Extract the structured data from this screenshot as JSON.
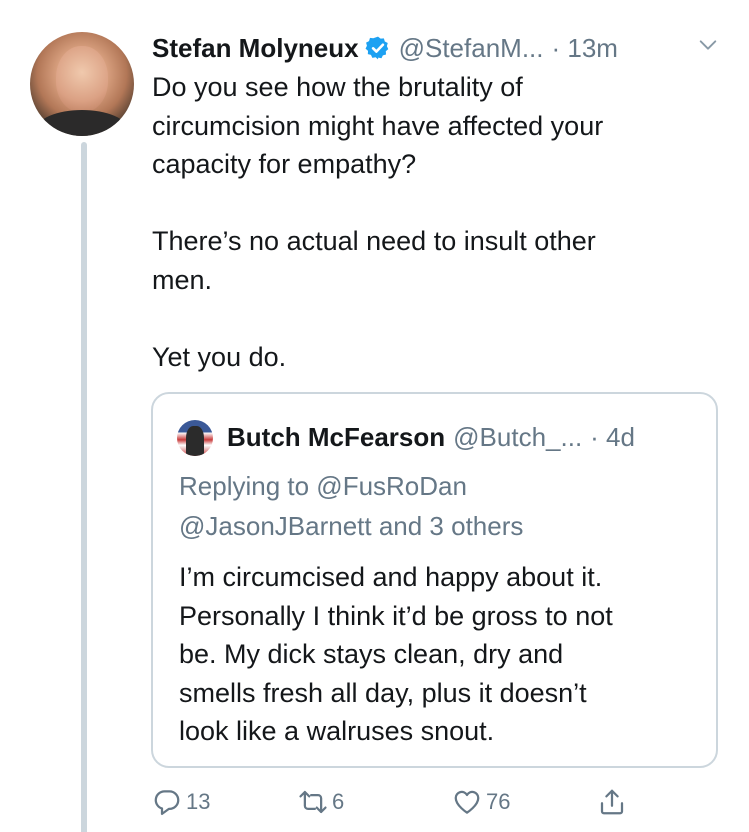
{
  "tweet": {
    "author_name": "Stefan Molyneux",
    "author_handle": "@StefanM...",
    "time": "· 13m",
    "text_lines": [
      "Do you see how the brutality of",
      "circumcision might have affected your",
      "capacity for empathy?",
      "",
      "There’s no actual need to insult other",
      "men.",
      "",
      "Yet you do."
    ]
  },
  "quoted": {
    "author_name": "Butch McFearson",
    "author_handle": "@Butch_...",
    "time": "· 4d",
    "replying_line1": "Replying to @FusRoDan",
    "replying_line2": "@JasonJBarnett and 3 others",
    "text_lines": [
      "I’m circumcised and happy about it.",
      "Personally I think it’d be gross to not",
      "be. My dick stays clean, dry and",
      "smells fresh all day, plus it doesn’t",
      "look like a walruses snout."
    ]
  },
  "actions": {
    "replies": "13",
    "retweets": "6",
    "likes": "76"
  },
  "icons": {
    "verified": "verified-badge-icon",
    "more": "chevron-down-icon",
    "reply": "reply-icon",
    "retweet": "retweet-icon",
    "like": "heart-icon",
    "share": "share-icon"
  },
  "colors": {
    "text": "#14171a",
    "secondary": "#657786",
    "verified": "#1da1f2",
    "border": "#ccd6dd"
  }
}
